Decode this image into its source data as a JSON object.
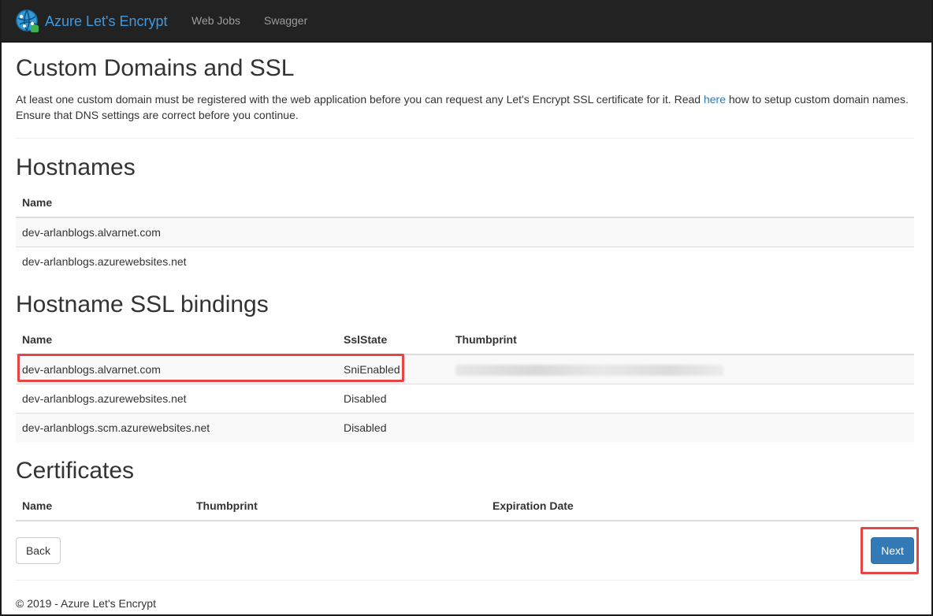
{
  "app": {
    "brand": "Azure Let's Encrypt",
    "brand_color": "#3b9ae1",
    "nav": [
      "Web Jobs",
      "Swagger"
    ]
  },
  "page": {
    "title": "Custom Domains and SSL",
    "intro_before_link": "At least one custom domain must be registered with the web application before you can request any Let's Encrypt SSL certificate for it. Read ",
    "intro_link": "here",
    "intro_after_link": " how to setup custom domain names. Ensure that DNS settings are correct before you continue."
  },
  "hostnames": {
    "heading": "Hostnames",
    "columns": [
      "Name"
    ],
    "rows": [
      "dev-arlanblogs.alvarnet.com",
      "dev-arlanblogs.azurewebsites.net"
    ]
  },
  "bindings": {
    "heading": "Hostname SSL bindings",
    "columns": [
      "Name",
      "SslState",
      "Thumbprint"
    ],
    "rows": [
      {
        "name": "dev-arlanblogs.alvarnet.com",
        "state": "SniEnabled",
        "thumbprint_redacted": true
      },
      {
        "name": "dev-arlanblogs.azurewebsites.net",
        "state": "Disabled",
        "thumbprint_redacted": false
      },
      {
        "name": "dev-arlanblogs.scm.azurewebsites.net",
        "state": "Disabled",
        "thumbprint_redacted": false
      }
    ]
  },
  "certificates": {
    "heading": "Certificates",
    "columns": [
      "Name",
      "Thumbprint",
      "Expiration Date"
    ],
    "rows": []
  },
  "actions": {
    "back_label": "Back",
    "next_label": "Next"
  },
  "footer": {
    "text": "© 2019 - Azure Let's Encrypt"
  },
  "colors": {
    "navbar_bg": "#222222",
    "primary": "#337ab7",
    "highlight": "#e64545",
    "link": "#337ab7"
  }
}
